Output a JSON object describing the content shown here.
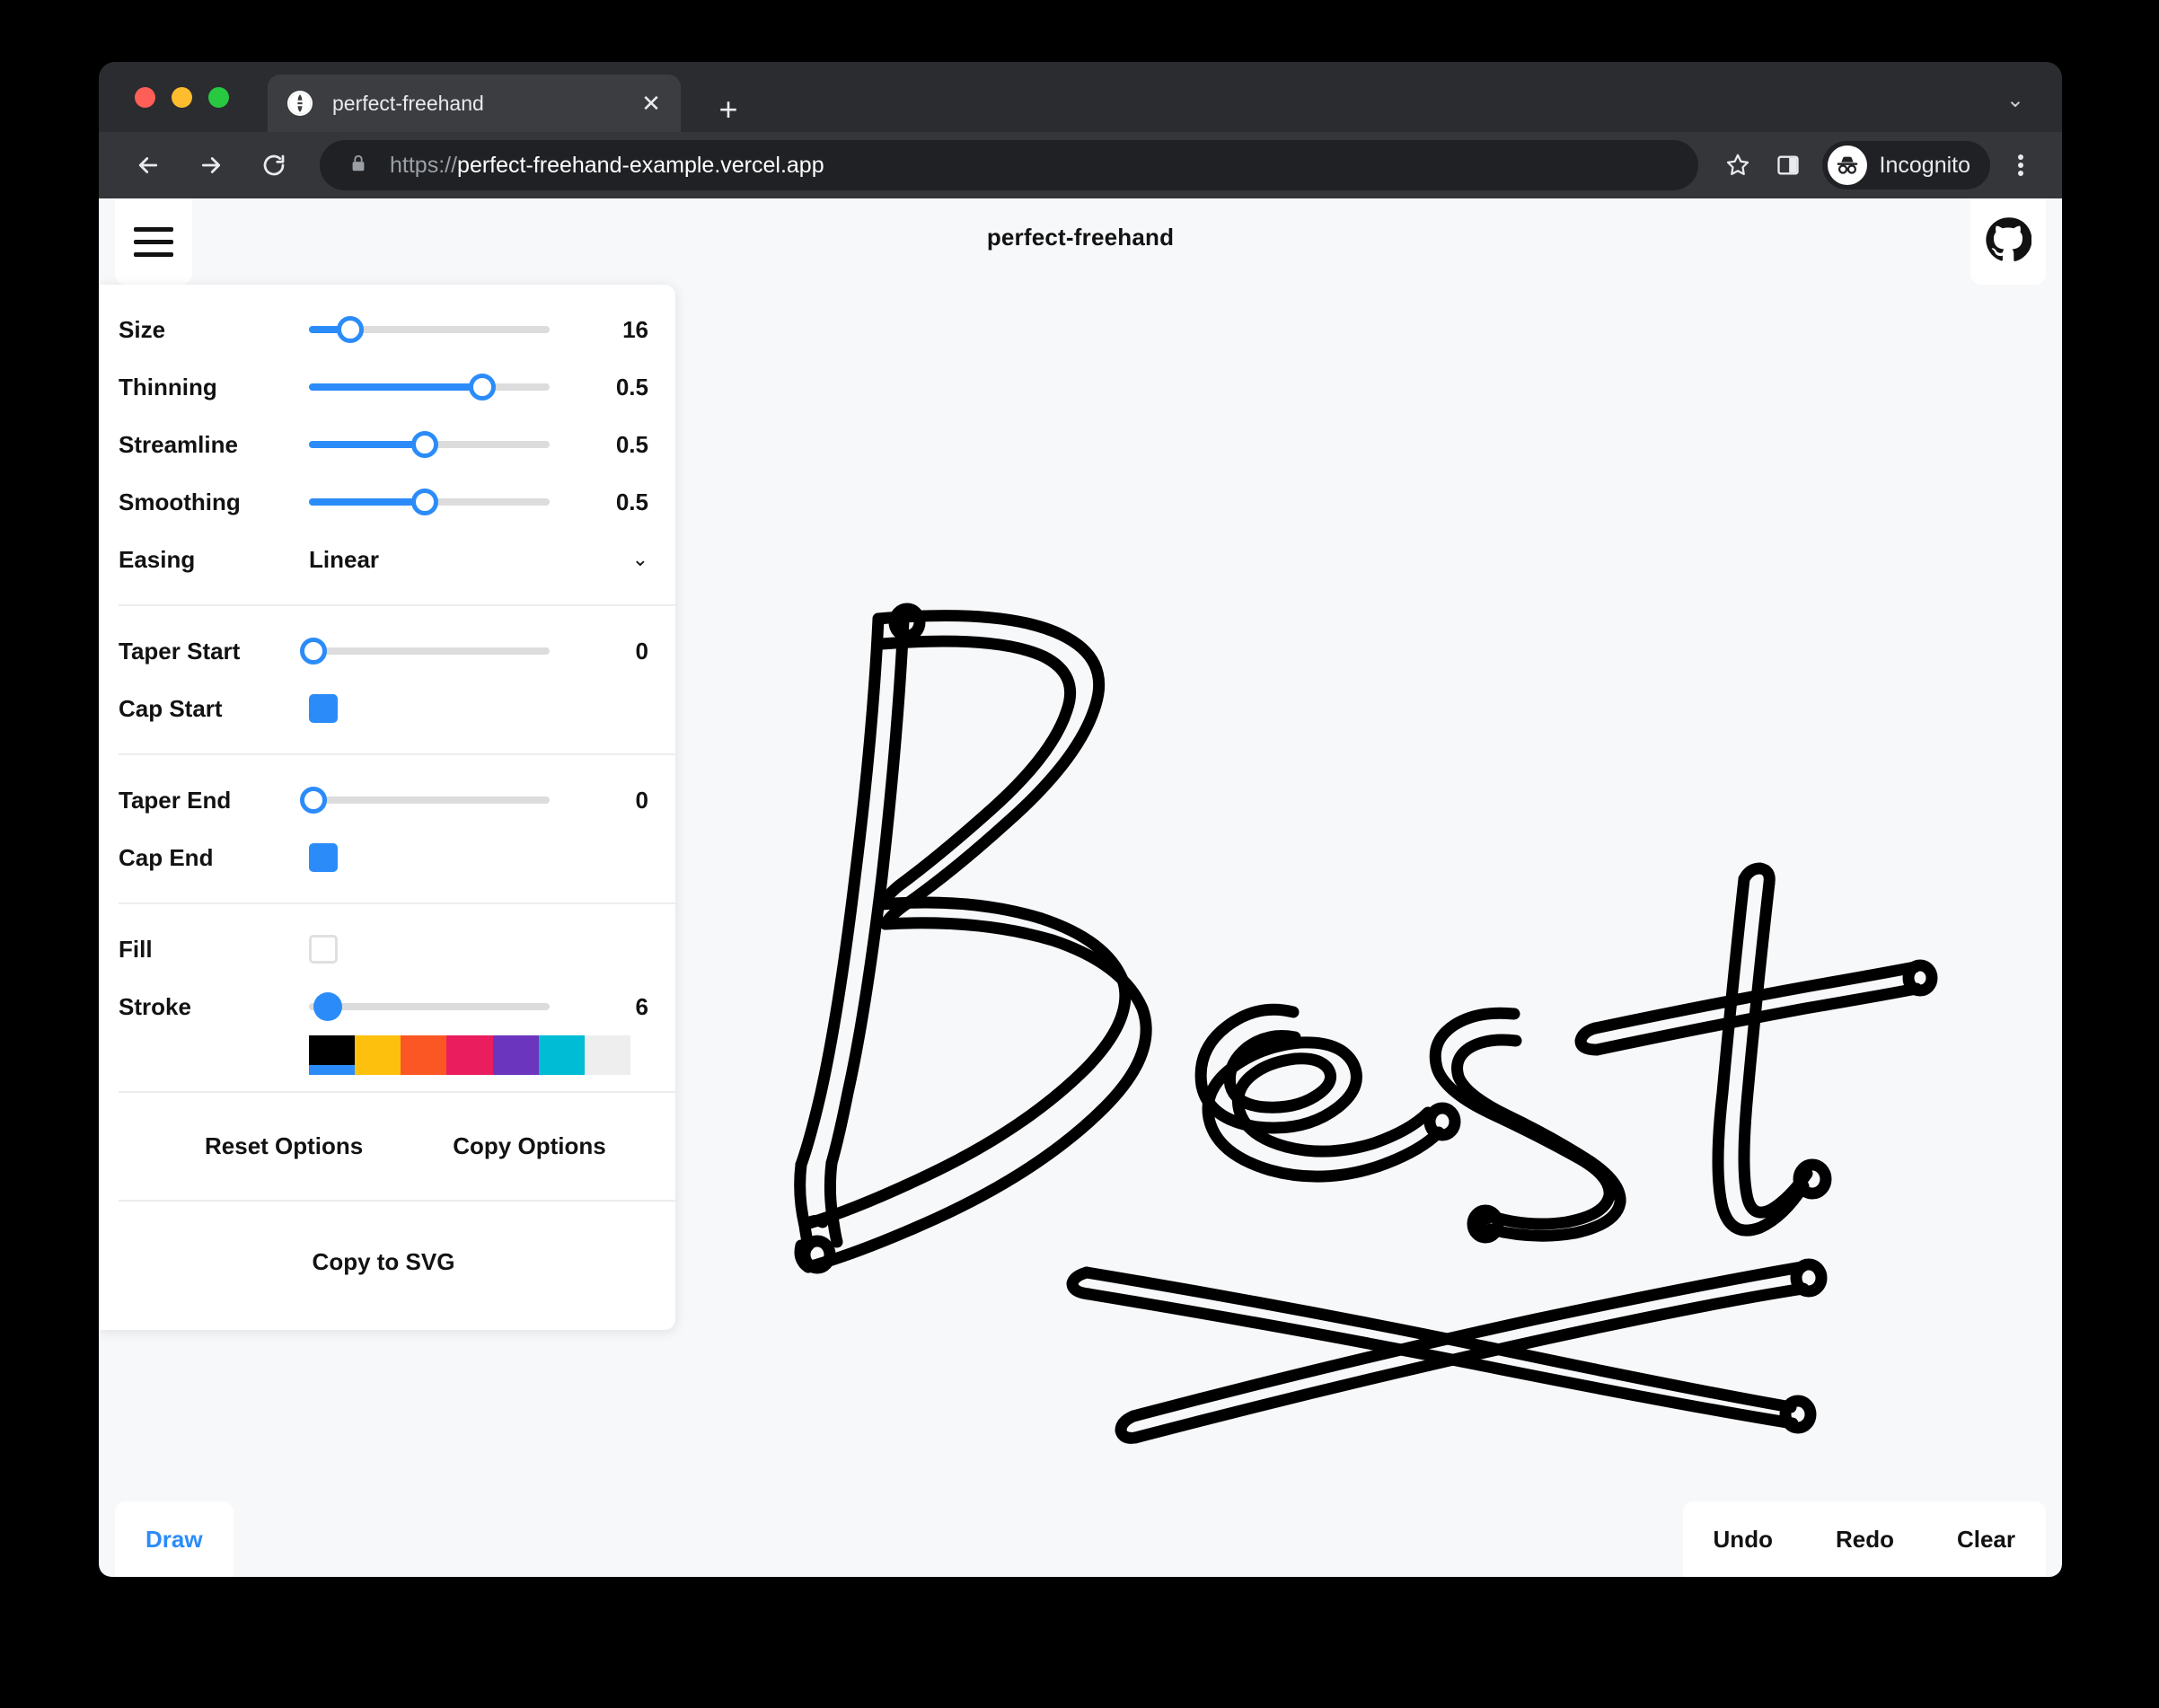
{
  "browser": {
    "tab": {
      "title": "perfect-freehand",
      "favicon": "globe-icon",
      "close": "✕"
    },
    "new_tab": "+",
    "tabstrip_chevron": "⌄",
    "omnibox": {
      "scheme": "https://",
      "host": "perfect-freehand-example.vercel.app",
      "lock": "lock-icon"
    },
    "profile": {
      "label": "Incognito"
    }
  },
  "app": {
    "title": "perfect-freehand",
    "menu_icon": "hamburger-icon",
    "github_icon": "github-icon"
  },
  "controls": {
    "stroke_section": [
      {
        "label": "Size",
        "value": "16",
        "pct": 17
      },
      {
        "label": "Thinning",
        "value": "0.5",
        "pct": 72
      },
      {
        "label": "Streamline",
        "value": "0.5",
        "pct": 48
      },
      {
        "label": "Smoothing",
        "value": "0.5",
        "pct": 48
      }
    ],
    "easing": {
      "label": "Easing",
      "value": "Linear",
      "chevron": "⌄"
    },
    "taper_start": {
      "label": "Taper Start",
      "value": "0",
      "pct": 0
    },
    "cap_start": {
      "label": "Cap Start",
      "checked": true
    },
    "taper_end": {
      "label": "Taper End",
      "value": "0",
      "pct": 0
    },
    "cap_end": {
      "label": "Cap End",
      "checked": true
    },
    "fill": {
      "label": "Fill",
      "checked": false
    },
    "stroke": {
      "label": "Stroke",
      "value": "6",
      "pct": 8
    },
    "swatches": [
      {
        "color": "#000000",
        "selected": true
      },
      {
        "color": "#FDC10D",
        "selected": false
      },
      {
        "color": "#FB5724",
        "selected": false
      },
      {
        "color": "#EA1E5E",
        "selected": false
      },
      {
        "color": "#6B35BE",
        "selected": false
      },
      {
        "color": "#00BCD4",
        "selected": false
      },
      {
        "color": "#EEEEEE",
        "selected": false
      }
    ],
    "reset_options": "Reset Options",
    "copy_options": "Copy Options",
    "copy_to_svg": "Copy to SVG"
  },
  "toolbar": {
    "draw": "Draw",
    "undo": "Undo",
    "redo": "Redo",
    "clear": "Clear"
  },
  "canvas": {
    "ink_color": "#000000",
    "background": "#F7F8FA",
    "content_description": "Handwritten word 'Best' with an X-shaped underline, drawn as outlined freehand strokes"
  },
  "colors": {
    "accent": "#2B8CF9",
    "panel": "#FFFFFF",
    "text": "#121212"
  }
}
